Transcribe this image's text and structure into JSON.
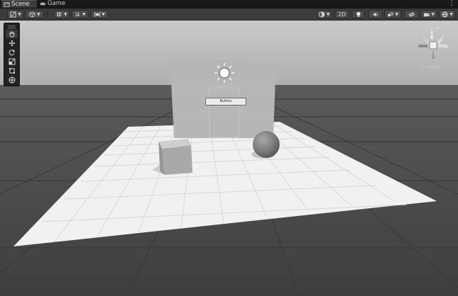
{
  "tabs": [
    {
      "label": "Scene",
      "icon": "scene-tab-icon",
      "active": true
    },
    {
      "label": "Game",
      "icon": "game-controller-icon",
      "active": false
    }
  ],
  "tab_menu_glyph": "⋮",
  "toolbar": {
    "left": [
      {
        "name": "transform-tool-dropdown",
        "icon": "transform-icon"
      },
      {
        "name": "view-options-dropdown",
        "icon": "cube-icon"
      },
      {
        "name": "grid-visibility-dropdown",
        "icon": "grid-icon"
      },
      {
        "name": "snap-increment-dropdown",
        "icon": "grid-snap-icon"
      },
      {
        "name": "align-dropdown",
        "icon": "align-icon"
      }
    ],
    "right": [
      {
        "name": "shading-mode-dropdown",
        "icon": "shading-icon"
      },
      {
        "name": "2d-toggle",
        "label": "2D"
      },
      {
        "name": "lighting-toggle",
        "icon": "lightbulb-icon"
      },
      {
        "name": "audio-toggle",
        "icon": "audio-icon"
      },
      {
        "name": "effects-dropdown",
        "icon": "effects-icon"
      },
      {
        "name": "hidden-objects-toggle",
        "icon": "eye-slash-icon"
      },
      {
        "name": "camera-dropdown",
        "icon": "camera-icon"
      },
      {
        "name": "gizmos-dropdown",
        "icon": "gizmo-globe-icon"
      }
    ]
  },
  "scene_tools": [
    {
      "name": "view-tool",
      "icon": "hand-icon",
      "active": true
    },
    {
      "name": "move-tool",
      "icon": "move-arrows-icon"
    },
    {
      "name": "rotate-tool",
      "icon": "rotate-icon"
    },
    {
      "name": "scale-tool",
      "icon": "scale-icon"
    },
    {
      "name": "rect-tool",
      "icon": "rect-icon"
    },
    {
      "name": "transform-tool",
      "icon": "transform-globe-icon"
    }
  ],
  "scene": {
    "ui_button_label": "Button",
    "projection_label": "< Persp",
    "colors": {
      "sky_top": "#c6c6c6",
      "horizon": "#a9a9a9",
      "ground": "#474747",
      "plane": "#f3f3f3",
      "plane_grid": "#d6d6d6",
      "canvas_panel": "#b8b8b8"
    }
  }
}
